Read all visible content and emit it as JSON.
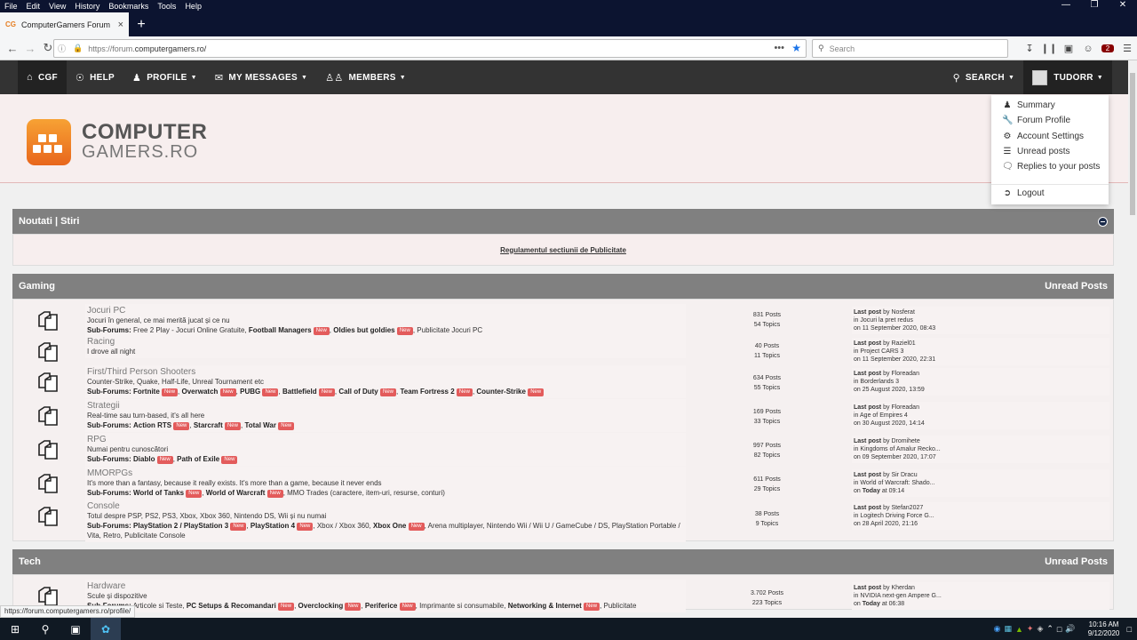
{
  "browser": {
    "menu": [
      "File",
      "Edit",
      "View",
      "History",
      "Bookmarks",
      "Tools",
      "Help"
    ],
    "tab_title": "ComputerGamers Forum",
    "tab_favicon": "CG",
    "url_scheme": "https://forum.",
    "url_domain": "computergamers.ro/",
    "search_placeholder": "Search",
    "ublock_badge": "2"
  },
  "sitenav": {
    "items": [
      {
        "label": "CGF",
        "icon": "home-icon"
      },
      {
        "label": "HELP",
        "icon": "lifebuoy-icon"
      },
      {
        "label": "PROFILE",
        "icon": "user-icon"
      },
      {
        "label": "MY MESSAGES",
        "icon": "envelope-icon"
      },
      {
        "label": "MEMBERS",
        "icon": "users-icon"
      }
    ],
    "search_label": "SEARCH",
    "user_label": "TUDORR"
  },
  "logo": {
    "line1": "COMPUTER",
    "line2": "GAMERS.RO"
  },
  "dropdown": {
    "items": [
      "Summary",
      "Forum Profile",
      "Account Settings",
      "Unread posts",
      "Replies to your posts"
    ],
    "logout": "Logout"
  },
  "news": {
    "title": "Noutati | Stiri",
    "link": "Regulamentul sectiunii de Publicitate"
  },
  "gaming": {
    "title": "Gaming",
    "unread_label": "Unread Posts",
    "new_badge": "New",
    "subforums_label": "Sub-Forums:",
    "last_post_label": "Last post",
    "by_label": "by",
    "in_label": "in",
    "on_label": "on",
    "forums": [
      {
        "title": "Jocuri PC",
        "desc": "Jocuri în general, ce mai merită jucat și ce nu",
        "subs": [
          {
            "name": "Free 2 Play - Jocuri Online Gratuite",
            "bold": false,
            "new": false
          },
          {
            "name": "Football Managers",
            "bold": true,
            "new": true
          },
          {
            "name": "Oldies but goldies",
            "bold": true,
            "new": true
          },
          {
            "name": "Publicitate Jocuri PC",
            "bold": false,
            "new": false
          }
        ],
        "posts": "831 Posts",
        "topics": "54 Topics",
        "last_by": "Nosferat",
        "last_in": "Jocuri la pret redus",
        "last_on": "11 September 2020, 08:43",
        "today": false
      },
      {
        "title": "Racing",
        "desc": "I drove all night",
        "subs": [],
        "posts": "40 Posts",
        "topics": "11 Topics",
        "last_by": "Raziel01",
        "last_in": "Project CARS 3",
        "last_on": "11 September 2020, 22:31",
        "today": false
      },
      {
        "title": "First/Third Person Shooters",
        "desc": "Counter-Strike, Quake, Half-Life, Unreal Tournament etc",
        "subs": [
          {
            "name": "Fortnite",
            "bold": true,
            "new": true
          },
          {
            "name": "Overwatch",
            "bold": true,
            "new": true
          },
          {
            "name": "PUBG",
            "bold": true,
            "new": true
          },
          {
            "name": "Battlefield",
            "bold": true,
            "new": true
          },
          {
            "name": "Call of Duty",
            "bold": true,
            "new": true
          },
          {
            "name": "Team Fortress 2",
            "bold": true,
            "new": true
          },
          {
            "name": "Counter-Strike",
            "bold": true,
            "new": true
          }
        ],
        "posts": "634 Posts",
        "topics": "55 Topics",
        "last_by": "Floreadan",
        "last_in": "Borderlands 3",
        "last_on": "25 August 2020, 13:59",
        "today": false
      },
      {
        "title": "Strategii",
        "desc": "Real-time sau turn-based, it's all here",
        "subs": [
          {
            "name": "Action RTS",
            "bold": true,
            "new": true
          },
          {
            "name": "Starcraft",
            "bold": true,
            "new": true
          },
          {
            "name": "Total War",
            "bold": true,
            "new": true
          }
        ],
        "posts": "169 Posts",
        "topics": "33 Topics",
        "last_by": "Floreadan",
        "last_in": "Age of Empires 4",
        "last_on": "30 August 2020, 14:14",
        "today": false
      },
      {
        "title": "RPG",
        "desc": "Numai pentru cunoscători",
        "subs": [
          {
            "name": "Diablo",
            "bold": true,
            "new": true
          },
          {
            "name": "Path of Exile",
            "bold": true,
            "new": true
          }
        ],
        "posts": "997 Posts",
        "topics": "82 Topics",
        "last_by": "Dromihete",
        "last_in": "Kingdoms of Amalur Recko...",
        "last_on": "09 September 2020, 17:07",
        "today": false
      },
      {
        "title": "MMORPGs",
        "desc": "It's more than a fantasy, because it really exists. It's more than a game, because it never ends",
        "subs": [
          {
            "name": "World of Tanks",
            "bold": true,
            "new": true
          },
          {
            "name": "World of Warcraft",
            "bold": true,
            "new": true
          },
          {
            "name": "MMO Trades (caractere, item-uri, resurse, conturi)",
            "bold": false,
            "new": false
          }
        ],
        "posts": "611 Posts",
        "topics": "29 Topics",
        "last_by": "Sir Dracu",
        "last_in": "World of Warcraft: Shado...",
        "last_on": "Today",
        "last_time": "at 09:14",
        "today": true
      },
      {
        "title": "Console",
        "desc": "Totul despre PSP, PS2, PS3, Xbox, Xbox 360, Nintendo DS, Wii și nu numai",
        "subs": [
          {
            "name": "PlayStation 2 / PlayStation 3",
            "bold": true,
            "new": true
          },
          {
            "name": "PlayStation 4",
            "bold": true,
            "new": true
          },
          {
            "name": "Xbox / Xbox 360",
            "bold": false,
            "new": false
          },
          {
            "name": "Xbox One",
            "bold": true,
            "new": true
          },
          {
            "name": "Arena multiplayer, Nintendo Wii / Wii U / GameCube / DS, PlayStation Portable / Vita, Retro, Publicitate Console",
            "bold": false,
            "new": false
          }
        ],
        "posts": "38 Posts",
        "topics": "9 Topics",
        "last_by": "Stefan2027",
        "last_in": "Logitech Driving Force G...",
        "last_on": "28 April 2020, 21:16",
        "today": false
      }
    ]
  },
  "tech": {
    "title": "Tech",
    "unread_label": "Unread Posts",
    "forums": [
      {
        "title": "Hardware",
        "desc": "Scule și dispozitive",
        "subs": [
          {
            "name": "Articole si Teste",
            "bold": false,
            "new": false
          },
          {
            "name": "PC Setups & Recomandari",
            "bold": true,
            "new": true
          },
          {
            "name": "Overclocking",
            "bold": true,
            "new": true
          },
          {
            "name": "Periferice",
            "bold": true,
            "new": true
          },
          {
            "name": "Imprimante si consumabile",
            "bold": false,
            "new": false
          },
          {
            "name": "Networking & Internet",
            "bold": true,
            "new": true
          },
          {
            "name": "Publicitate",
            "bold": false,
            "new": false
          }
        ],
        "posts": "3.702 Posts",
        "topics": "223 Topics",
        "last_by": "Kherdan",
        "last_in": "NVIDIA next-gen Ampere G...",
        "last_on": "Today",
        "last_time": "at 06:38",
        "today": true
      }
    ]
  },
  "status_url": "https://forum.computergamers.ro/profile/",
  "taskbar": {
    "time": "10:16 AM",
    "date": "9/12/2020"
  }
}
